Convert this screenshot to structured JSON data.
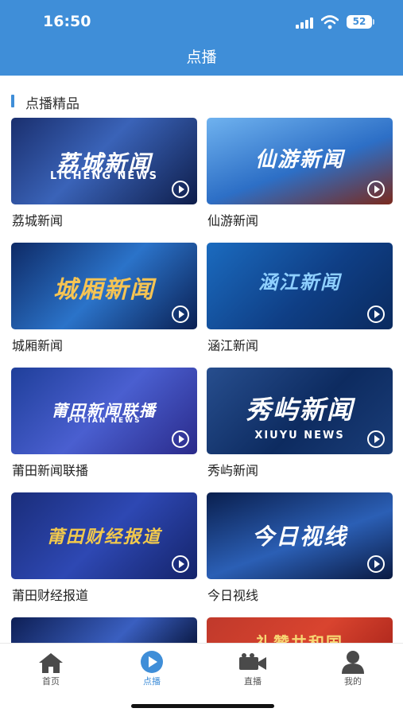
{
  "status": {
    "time": "16:50",
    "battery": "52"
  },
  "header": {
    "title": "点播"
  },
  "section": {
    "title": "点播精品"
  },
  "programs": [
    {
      "label": "荔城新闻",
      "thumb_title": "荔城新闻",
      "thumb_subtitle": "LICHENG NEWS"
    },
    {
      "label": "仙游新闻",
      "thumb_title": "仙游新闻",
      "thumb_subtitle": ""
    },
    {
      "label": "城厢新闻",
      "thumb_title": "城厢新闻",
      "thumb_subtitle": ""
    },
    {
      "label": "涵江新闻",
      "thumb_title": "涵江新闻",
      "thumb_subtitle": ""
    },
    {
      "label": "莆田新闻联播",
      "thumb_title": "莆田新闻联播",
      "thumb_subtitle": "PUTIAN NEWS"
    },
    {
      "label": "秀屿新闻",
      "thumb_title": "秀屿新闻",
      "thumb_subtitle": "XIUYU NEWS"
    },
    {
      "label": "莆田财经报道",
      "thumb_title": "莆田财经报道",
      "thumb_subtitle": ""
    },
    {
      "label": "今日视线",
      "thumb_title": "今日视线",
      "thumb_subtitle": ""
    },
    {
      "label": "",
      "thumb_title": "",
      "thumb_subtitle": ""
    },
    {
      "label": "",
      "thumb_title": "礼赞共和国",
      "thumb_subtitle": ""
    }
  ],
  "tabs": [
    {
      "label": "首页",
      "icon": "home-icon"
    },
    {
      "label": "点播",
      "icon": "play-circle-icon"
    },
    {
      "label": "直播",
      "icon": "video-camera-icon"
    },
    {
      "label": "我的",
      "icon": "person-icon"
    }
  ],
  "colors": {
    "accent": "#3f8ed8"
  }
}
